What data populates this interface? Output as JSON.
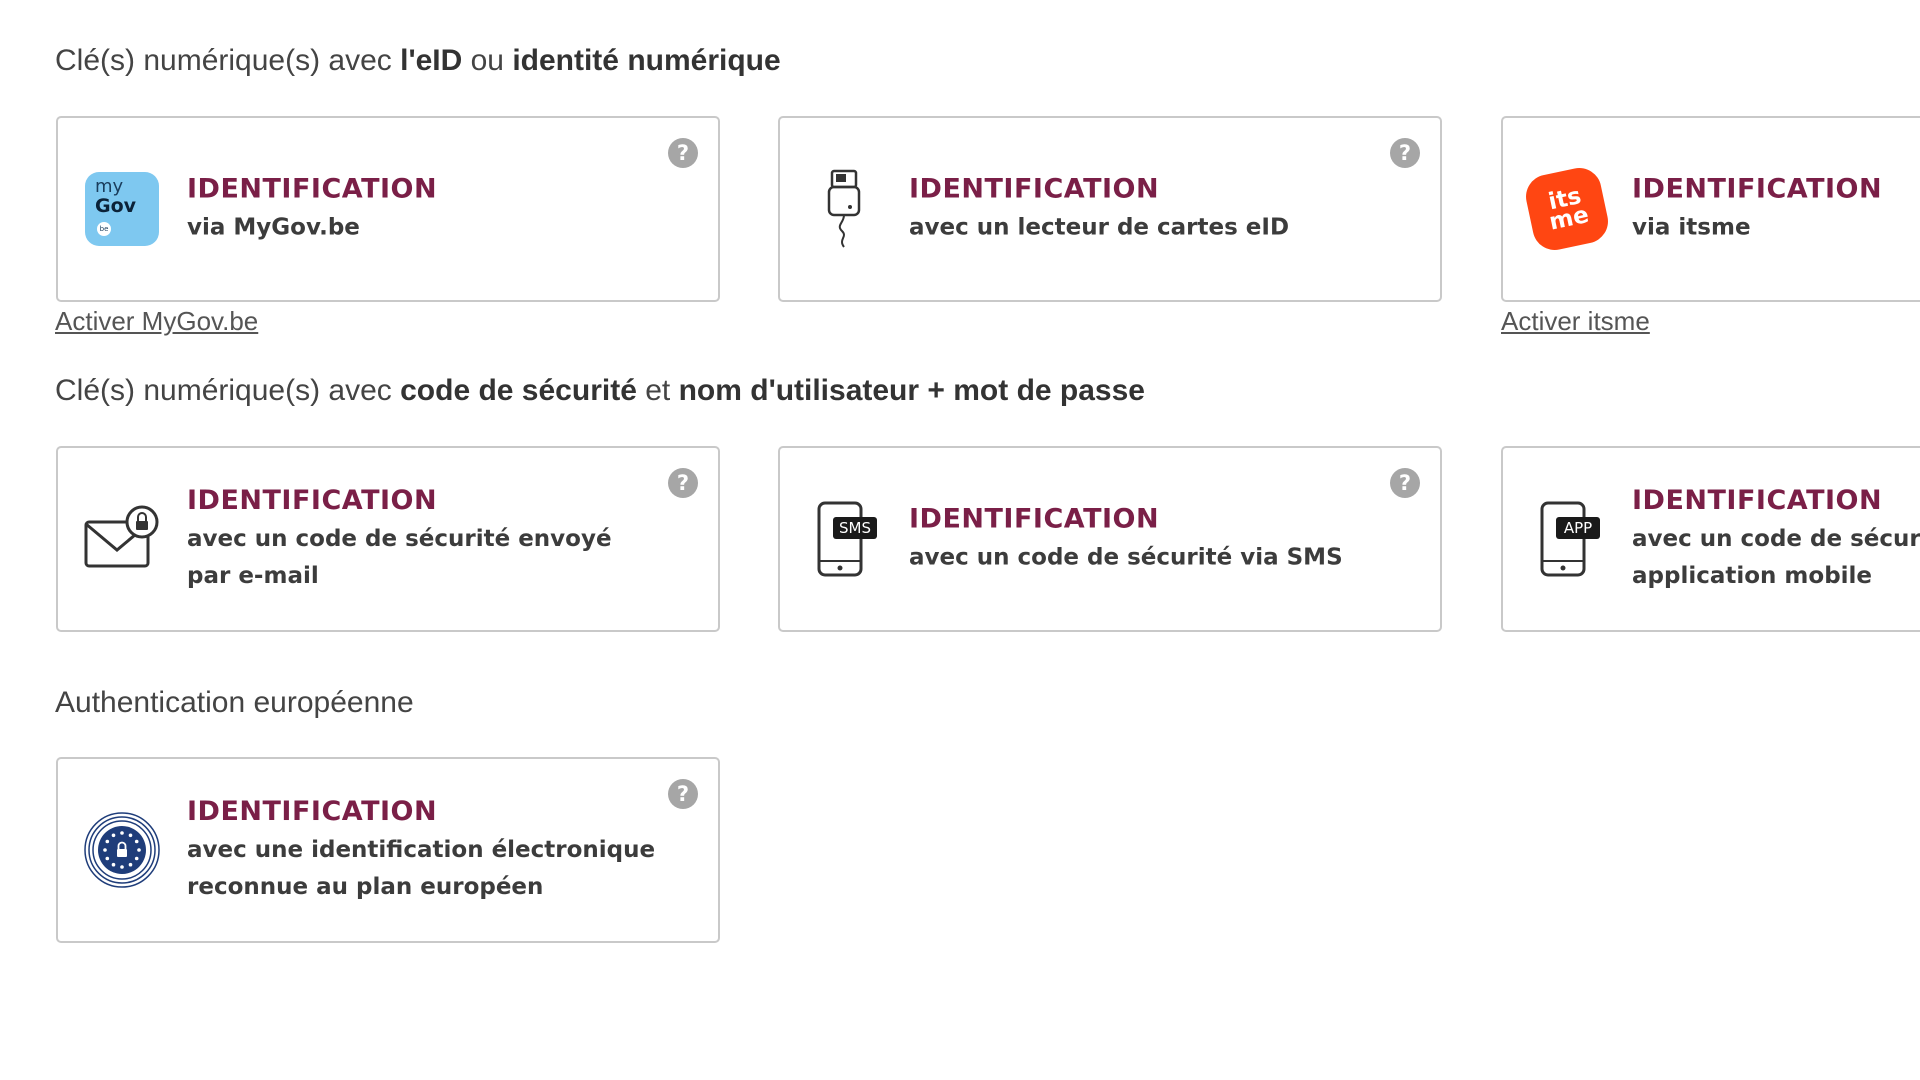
{
  "sections": {
    "eid": {
      "prefix": "Clé(s) numérique(s) avec ",
      "bold1": "l'eID",
      "mid": " ou ",
      "bold2": "identité numérique"
    },
    "code": {
      "prefix": "Clé(s) numérique(s) avec ",
      "bold1": "code de sécurité",
      "mid": " et ",
      "bold2": "nom d'utilisateur + mot de passe"
    },
    "europe": {
      "title": "Authentication européenne"
    }
  },
  "cards": {
    "mygov": {
      "title": "IDENTIFICATION",
      "subtitle": "via MyGov.be",
      "icon": "mygov-logo",
      "logo_my": "my",
      "logo_gov": "Gov",
      "logo_be": "be",
      "help": "?",
      "link": "Activer MyGov.be"
    },
    "eid_reader": {
      "title": "IDENTIFICATION",
      "subtitle": "avec un lecteur de cartes eID",
      "icon": "card-reader-icon",
      "help": "?"
    },
    "itsme": {
      "title": "IDENTIFICATION",
      "subtitle": "via itsme",
      "icon": "itsme-logo",
      "logo_its": "its",
      "logo_me": "me",
      "link": "Activer itsme"
    },
    "email": {
      "title": "IDENTIFICATION",
      "subtitle": "avec un code de sécurité envoyé par e-mail",
      "icon": "envelope-lock-icon",
      "help": "?"
    },
    "sms": {
      "title": "IDENTIFICATION",
      "subtitle": "avec un code de sécurité via SMS",
      "icon": "phone-sms-icon",
      "badge": "SMS",
      "help": "?"
    },
    "app": {
      "title": "IDENTIFICATION",
      "subtitle": "avec un code de sécurité via une application mobile",
      "icon": "phone-app-icon",
      "badge": "APP"
    },
    "eidas": {
      "title": "IDENTIFICATION",
      "subtitle": "avec une identification électronique reconnue au plan européen",
      "icon": "eu-eidas-icon",
      "help": "?"
    }
  },
  "colors": {
    "title": "#7a1f47",
    "border": "#c9c9c9",
    "help": "#a6a6a6",
    "mygov": "#7ec8f0",
    "itsme": "#ff4612",
    "eu_blue": "#1f3d7a"
  }
}
